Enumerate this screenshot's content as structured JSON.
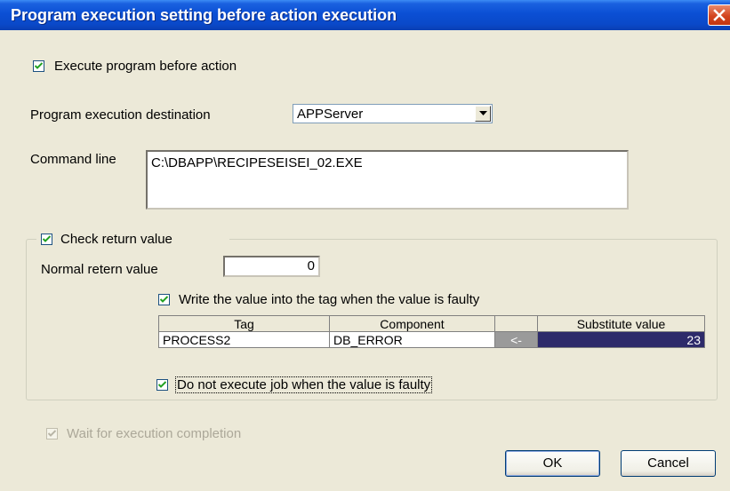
{
  "window": {
    "title": "Program execution setting before action execution"
  },
  "execute_program": {
    "label": "Execute program before action",
    "checked": true
  },
  "destination": {
    "label": "Program execution destination",
    "value": "APPServer"
  },
  "command_line": {
    "label": "Command line",
    "value": "C:\\DBAPP\\RECIPESEISEI_02.EXE"
  },
  "check_return": {
    "label": "Check return value",
    "checked": true,
    "normal_label": "Normal retern value",
    "normal_value": "0",
    "write_label": "Write the value into the tag when the value is faulty",
    "write_checked": true,
    "grid": {
      "headers": [
        "Tag",
        "Component",
        "",
        "Substitute value"
      ],
      "row": {
        "tag": "PROCESS2",
        "component": "DB_ERROR",
        "arrow": "<-",
        "substitute": "23"
      }
    },
    "no_exec_label": "Do not execute job when the value is faulty",
    "no_exec_checked": true
  },
  "wait_completion": {
    "label": "Wait for execution completion",
    "checked": true,
    "enabled": false
  },
  "buttons": {
    "ok": "OK",
    "cancel": "Cancel"
  },
  "colors": {
    "titlebar": "#0a49c9",
    "close_button": "#d3451f",
    "dialog_bg": "#ece9d8",
    "selection": "#2d2a6a"
  }
}
